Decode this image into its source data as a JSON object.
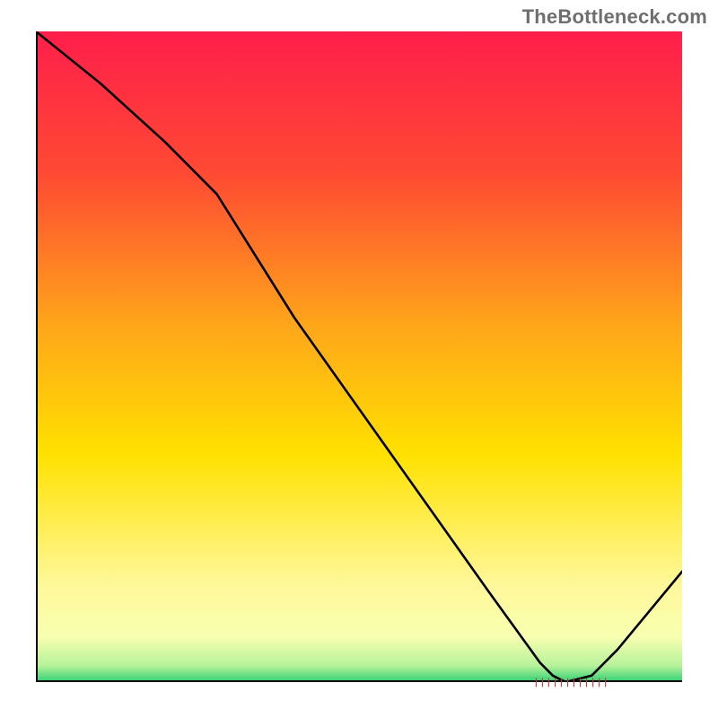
{
  "watermark": "TheBottleneck.com",
  "hash_strip_text": "||||||||||||",
  "chart_data": {
    "type": "line",
    "title": "",
    "xlabel": "",
    "ylabel": "",
    "xlim": [
      0,
      100
    ],
    "ylim": [
      0,
      100
    ],
    "grid": false,
    "legend": false,
    "background_gradient": {
      "top": "#ff1e4b",
      "upper_mid": "#ff6a2a",
      "mid": "#ffd400",
      "lower_mid": "#fff99a",
      "bottom": "#2ecf73"
    },
    "series": [
      {
        "name": "bottleneck-curve",
        "color": "#000000",
        "x": [
          0,
          10,
          20,
          28,
          40,
          50,
          60,
          70,
          78,
          80,
          82,
          86,
          90,
          100
        ],
        "y": [
          100,
          92,
          83,
          75,
          56,
          42,
          28,
          14,
          3,
          1,
          0,
          1,
          5,
          17
        ]
      }
    ],
    "annotations": [
      {
        "name": "valley-hash-marker",
        "x_start": 77,
        "x_end": 87,
        "y": 0.5,
        "color": "#d43434"
      }
    ]
  }
}
